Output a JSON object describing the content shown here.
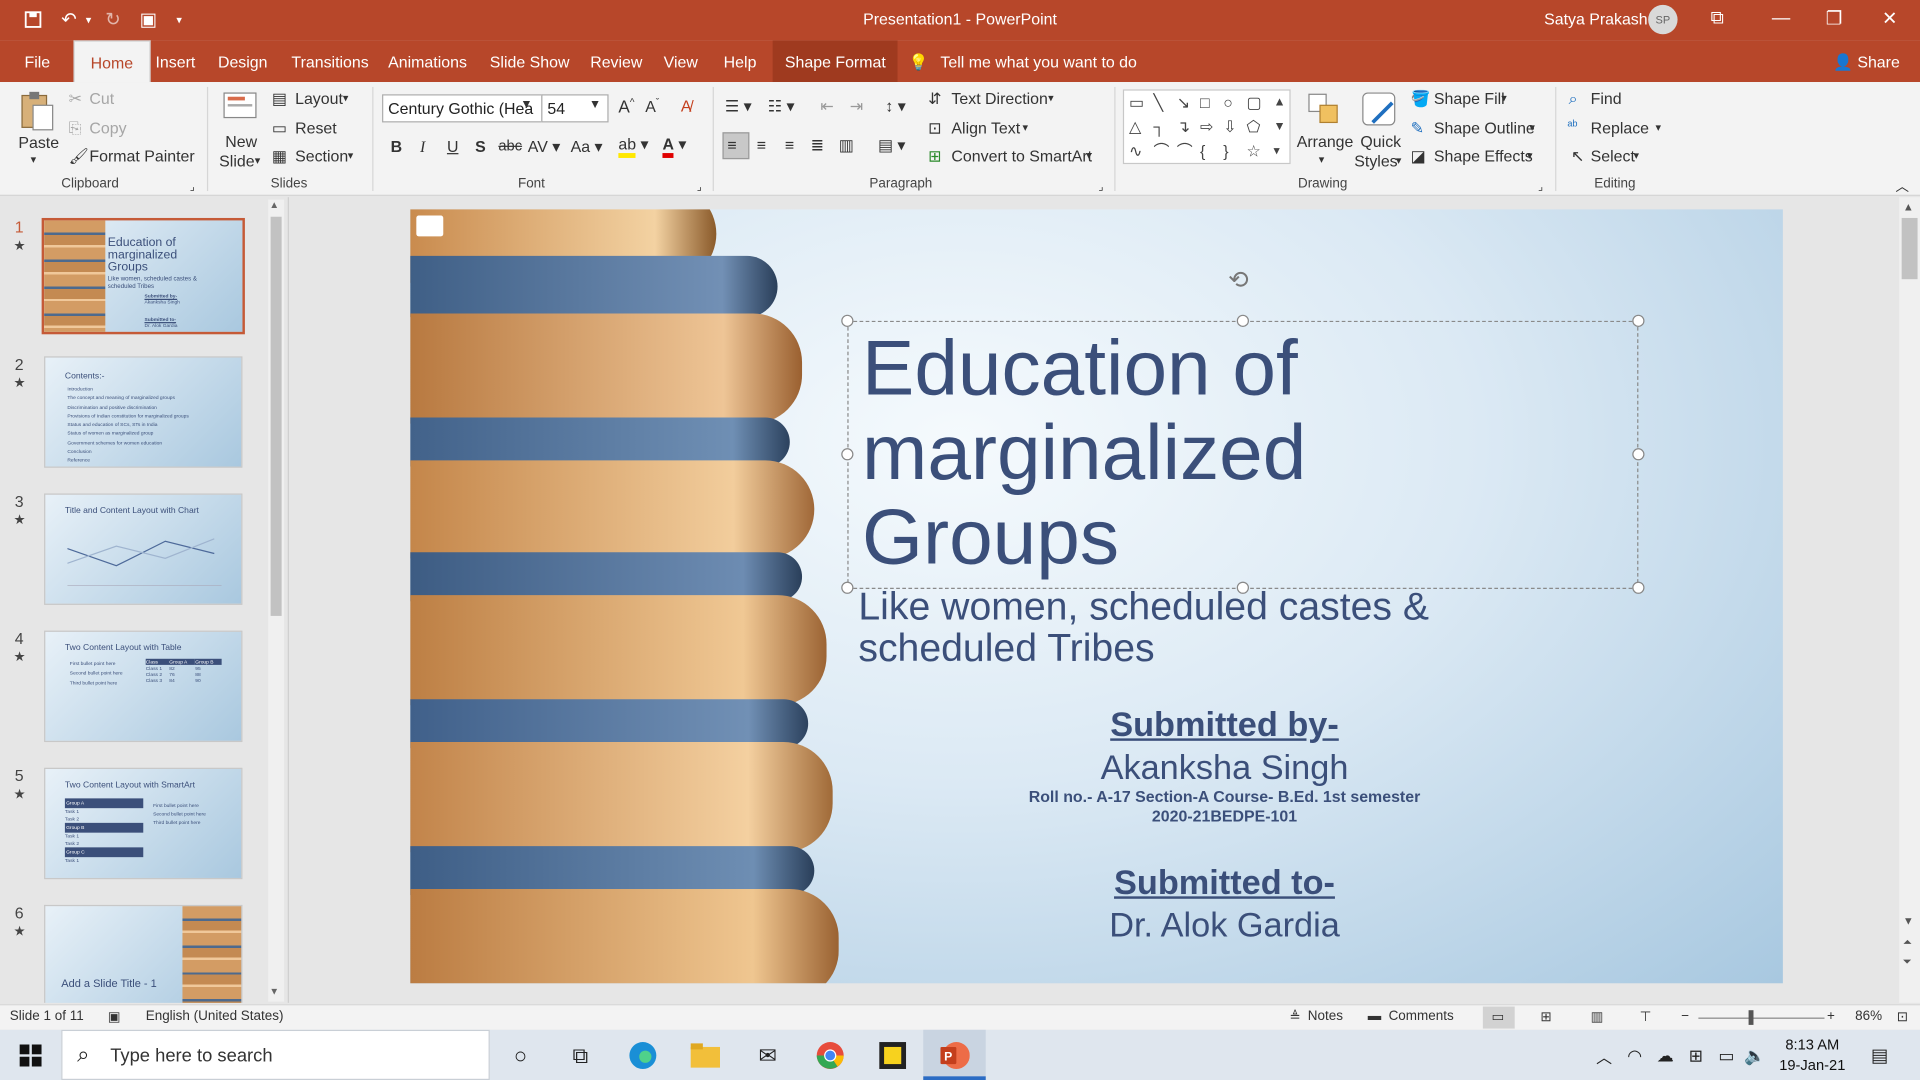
{
  "window": {
    "title": "Presentation1 - PowerPoint",
    "user": "Satya Prakash",
    "user_initials": "SP",
    "share": "Share"
  },
  "tabs": [
    "File",
    "Home",
    "Insert",
    "Design",
    "Transitions",
    "Animations",
    "Slide Show",
    "Review",
    "View",
    "Help",
    "Shape Format"
  ],
  "tell_me": "Tell me what you want to do",
  "clipboard": {
    "paste": "Paste",
    "cut": "Cut",
    "copy": "Copy",
    "format_painter": "Format Painter",
    "group": "Clipboard"
  },
  "slides_grp": {
    "new_slide_1": "New",
    "new_slide_2": "Slide",
    "layout": "Layout",
    "reset": "Reset",
    "section": "Section",
    "group": "Slides"
  },
  "font": {
    "family": "Century Gothic (Hea",
    "size": "54",
    "group": "Font"
  },
  "paragraph": {
    "text_direction": "Text Direction",
    "align_text": "Align Text",
    "smartart": "Convert to SmartArt",
    "group": "Paragraph"
  },
  "drawing": {
    "arrange": "Arrange",
    "quick_1": "Quick",
    "quick_2": "Styles",
    "shape_fill": "Shape Fill",
    "shape_outline": "Shape Outline",
    "shape_effects": "Shape Effects",
    "group": "Drawing"
  },
  "editing": {
    "find": "Find",
    "replace": "Replace",
    "select": "Select",
    "group": "Editing"
  },
  "thumbs": [
    {
      "num": "1",
      "title": "Education of marginalized Groups",
      "sub": "Like women, scheduled castes & scheduled Tribes",
      "by": "Submitted by-",
      "name": "Akanksha Singh",
      "to": "Submitted to-",
      "toname": "Dr. Alok Gardia"
    },
    {
      "num": "2",
      "title": "Contents:-",
      "items": [
        "Introduction",
        "The concept and meaning of marginalized groups",
        "Discrimination and positive discrimination",
        "Provisions of Indian constitution for marginalized groups",
        "Status and education of SCs, STs in India",
        "Status of women as marginalized group",
        "Government schemes for women education",
        "Conclusion",
        "Reference"
      ]
    },
    {
      "num": "3",
      "title": "Title and Content Layout with Chart"
    },
    {
      "num": "4",
      "title": "Two Content Layout with Table",
      "bullets": [
        "First bullet point here",
        "Second bullet point here",
        "Third bullet point here"
      ],
      "table_head": [
        "Class",
        "Group A",
        "Group B"
      ],
      "table_rows": [
        [
          "Class 1",
          "82",
          "95"
        ],
        [
          "Class 2",
          "76",
          "88"
        ],
        [
          "Class 3",
          "84",
          "90"
        ]
      ]
    },
    {
      "num": "5",
      "title": "Two Content Layout with SmartArt",
      "groups": [
        "Group A",
        "Group B",
        "Group C"
      ],
      "tasks": [
        "Task 1",
        "Task 2"
      ],
      "bullets": [
        "First bullet point here",
        "Second bullet point here",
        "Third bullet point here"
      ]
    },
    {
      "num": "6",
      "title": "Add a Slide Title - 1"
    }
  ],
  "slide": {
    "title_line1": "Education of",
    "title_line2": "marginalized",
    "title_line3": "Groups",
    "subtitle_line1": "Like women, scheduled castes &",
    "subtitle_line2": "scheduled Tribes",
    "submitted_by": "Submitted by-",
    "name": "Akanksha Singh",
    "roll": "Roll no.- A-17 Section-A Course- B.Ed. 1st semester",
    "code": "2020-21BEDPE-101",
    "submitted_to": "Submitted to-",
    "teacher": "Dr. Alok Gardia"
  },
  "status": {
    "slide": "Slide 1 of 11",
    "language": "English (United States)",
    "notes": "Notes",
    "comments": "Comments",
    "zoom": "86%"
  },
  "taskbar": {
    "search": "Type here to search",
    "time": "8:13 AM",
    "date": "19-Jan-21"
  }
}
